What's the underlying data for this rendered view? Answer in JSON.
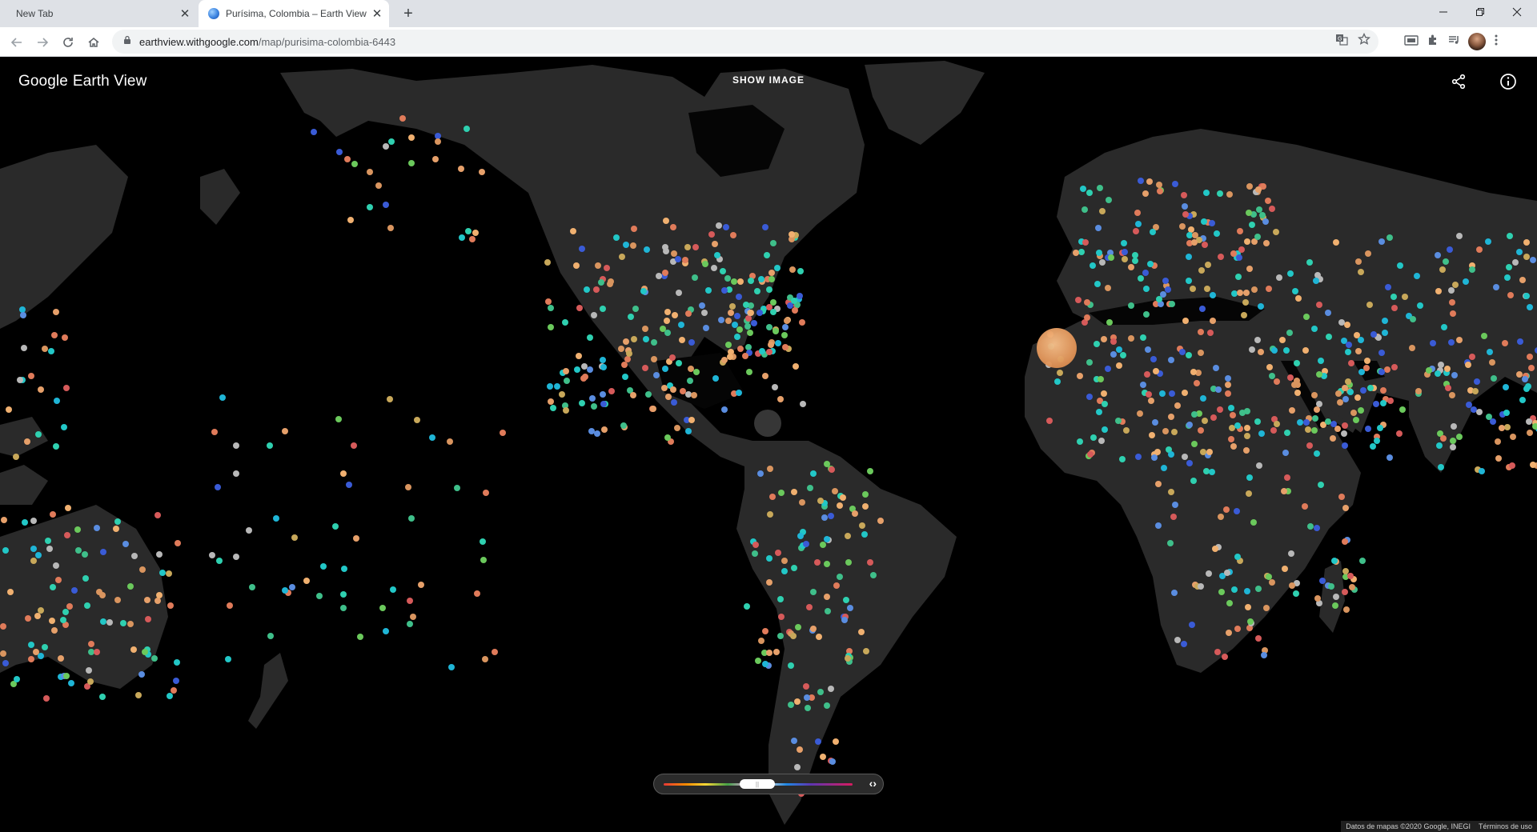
{
  "browser": {
    "tabs": [
      {
        "title": "New Tab",
        "active": false
      },
      {
        "title": "Purísima, Colombia – Earth View",
        "active": true
      }
    ],
    "url_host": "earthview.withgoogle.com",
    "url_path": "/map/purisima-colombia-6443"
  },
  "header": {
    "brand_google": "Google",
    "brand_product": "Earth View",
    "show_image_label": "SHOW IMAGE"
  },
  "icons": [
    "back-icon",
    "forward-icon",
    "reload-icon",
    "home-icon",
    "lock-icon",
    "translate-icon",
    "star-icon",
    "share-icon",
    "info-icon",
    "puzzle-icon",
    "cast-icon",
    "media-icon"
  ],
  "color_filter": {
    "arrows": "‹›"
  },
  "attribution": {
    "map_data": "Datos de mapas ©2020 Google, INEGI",
    "terms": "Términos de uso"
  },
  "colors": {
    "accent_orange": "#e3965a",
    "land": "#2a2a2a",
    "ocean": "#000000"
  }
}
